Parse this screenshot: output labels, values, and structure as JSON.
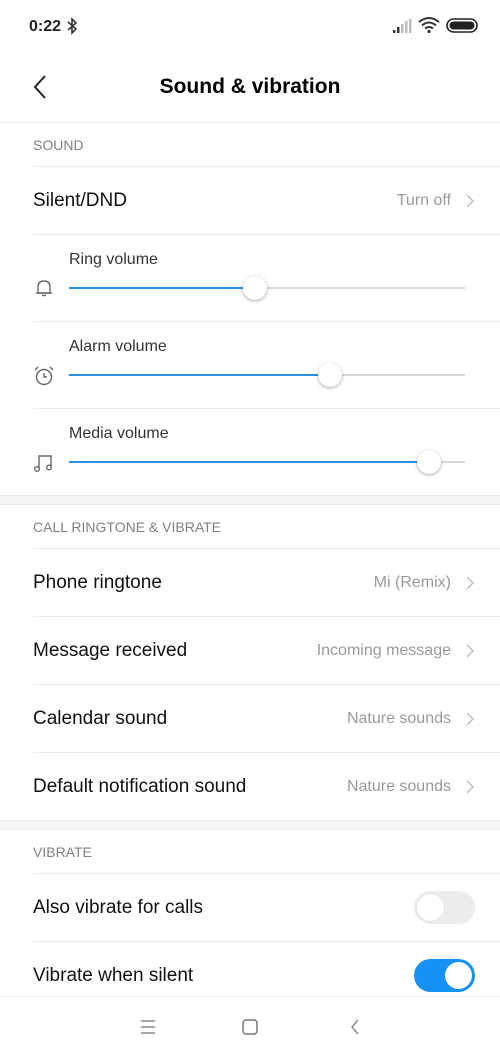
{
  "status_bar": {
    "time": "0:22",
    "icons": [
      "bluetooth-icon",
      "signal-icon",
      "wifi-icon",
      "battery-icon"
    ]
  },
  "header": {
    "title": "Sound & vibration",
    "back_icon": "chevron-left-icon"
  },
  "sections": {
    "sound": {
      "title": "SOUND",
      "silent_dnd": {
        "label": "Silent/DND",
        "value": "Turn off"
      },
      "sliders": [
        {
          "label": "Ring volume",
          "icon": "bell-icon",
          "value": 0.47
        },
        {
          "label": "Alarm volume",
          "icon": "alarm-clock-icon",
          "value": 0.66
        },
        {
          "label": "Media volume",
          "icon": "music-note-icon",
          "value": 0.91
        }
      ]
    },
    "ringtone": {
      "title": "CALL RINGTONE & VIBRATE",
      "items": [
        {
          "label": "Phone ringtone",
          "value": "Mi (Remix)"
        },
        {
          "label": "Message received",
          "value": "Incoming message"
        },
        {
          "label": "Calendar sound",
          "value": "Nature sounds"
        },
        {
          "label": "Default notification sound",
          "value": "Nature sounds"
        }
      ]
    },
    "vibrate": {
      "title": "VIBRATE",
      "items": [
        {
          "label": "Also vibrate for calls",
          "enabled": false
        },
        {
          "label": "Vibrate when silent",
          "enabled": true
        }
      ]
    }
  },
  "colors": {
    "accent": "#1591f7",
    "slider_fill": "#2b8ee0"
  },
  "nav_bar": {
    "buttons": [
      "menu-icon",
      "home-icon",
      "back-icon"
    ]
  }
}
